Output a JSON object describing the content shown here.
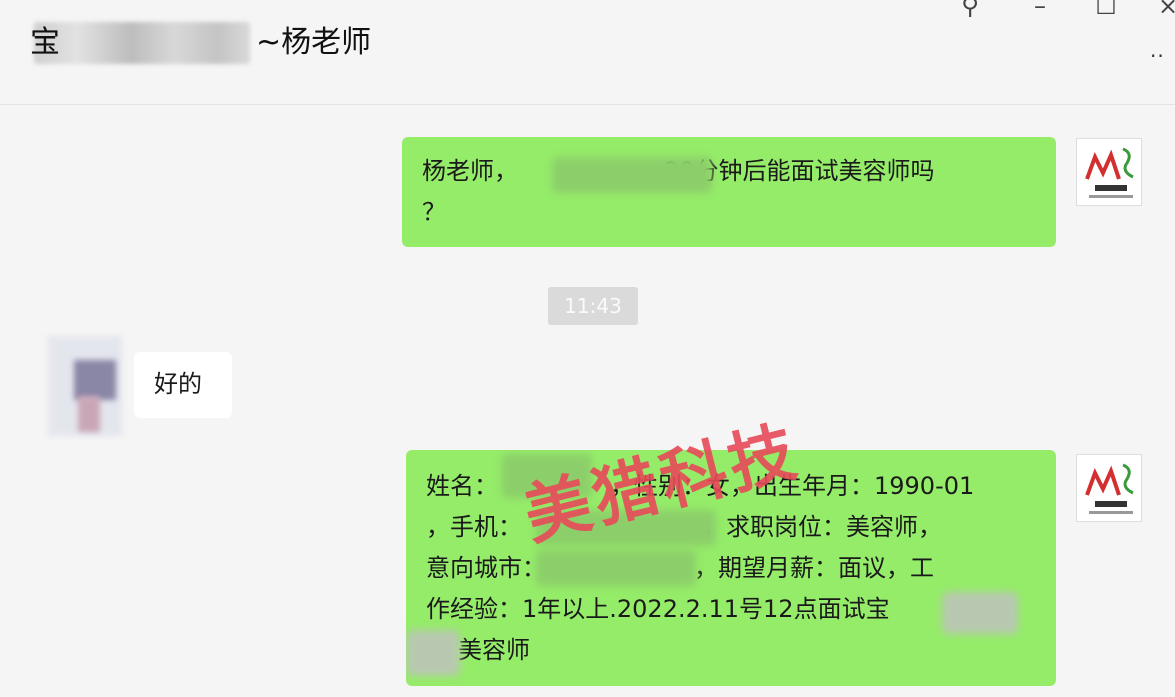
{
  "header": {
    "title_prefix": "宝",
    "title_suffix": "~杨老师"
  },
  "window_controls": {
    "pin_icon": "pin-icon",
    "minimize_icon": "minimize-icon",
    "maximize_icon": "maximize-icon",
    "close_icon": "close-icon",
    "more_icon": "more-icon"
  },
  "messages": [
    {
      "side": "me",
      "lines": [
        "杨老师，",
        "20分钟后能面试美容师吗",
        "？"
      ]
    },
    {
      "side": "time",
      "text": "11:43"
    },
    {
      "side": "other",
      "text": "好的"
    },
    {
      "side": "me",
      "lines": [
        "姓名：",
        "，性别：女，出生年月：1990-01",
        "，手机：",
        "，求职岗位：美容师，",
        "意向城市：",
        "，期望月薪：面议，工",
        "作经验：1年以上.2022.2.11号12点面试宝",
        "美容师"
      ]
    }
  ],
  "watermark": "美猎科技",
  "colors": {
    "my_bubble": "#95ec69",
    "other_bubble": "#ffffff",
    "background": "#f5f5f5",
    "watermark": "#e84a5a"
  }
}
